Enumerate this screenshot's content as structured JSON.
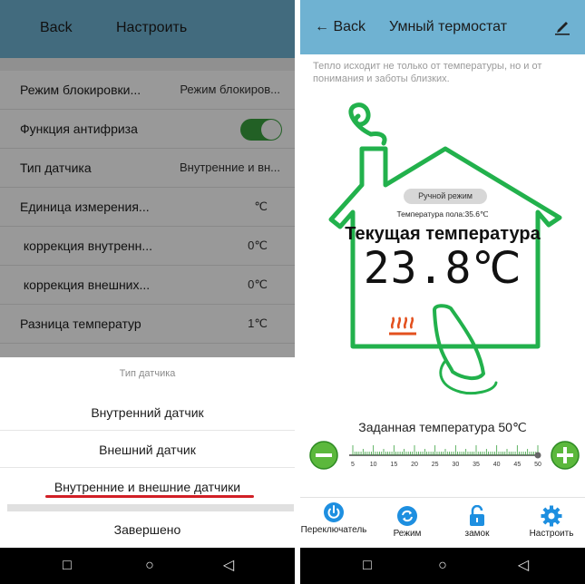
{
  "left": {
    "header": {
      "back": "Back",
      "title": "Настроить"
    },
    "settings": [
      {
        "label": "Режим блокировки...",
        "value": "Режим блокиров..."
      },
      {
        "label": "Функция антифриза",
        "toggle": true
      },
      {
        "label": "Тип датчика",
        "value": "Внутренние и вн..."
      },
      {
        "label": "Единица измерения...",
        "value": "℃"
      },
      {
        "label": " коррекция внутренн...",
        "value": "0℃"
      },
      {
        "label": " коррекция внешних...",
        "value": "0℃"
      },
      {
        "label": "Разница температур",
        "value": "1℃"
      }
    ],
    "sheet": {
      "title": "Тип датчика",
      "options": [
        "Внутренний датчик",
        "Внешний датчик",
        "Внутренние и внешние датчики"
      ],
      "selected_index": 2,
      "done": "Завершено"
    }
  },
  "right": {
    "header": {
      "back": "← Back",
      "title": "Умный термостат"
    },
    "quote": "Тепло исходит не только от температуры, но и от понимания и заботы близких.",
    "mode": "Ручной режим",
    "floor_temp": "Температура пола:35.6℃",
    "current_label": "Текущая температура",
    "current_temp": "23.8℃",
    "set_temp_label": "Заданная температура 50℃",
    "slider": {
      "ticks": [
        "5",
        "10",
        "15",
        "20",
        "25",
        "30",
        "35",
        "40",
        "45",
        "50"
      ],
      "value": 50
    },
    "tabs": [
      {
        "label": "Переключатель",
        "icon": "power-icon"
      },
      {
        "label": "Режим",
        "icon": "sync-icon"
      },
      {
        "label": "замок",
        "icon": "lock-icon"
      },
      {
        "label": "Настроить",
        "icon": "gear-icon"
      }
    ]
  },
  "nav": {
    "square": "□",
    "circle": "○",
    "back": "◁"
  },
  "colors": {
    "header": "#6fb2d2",
    "accent": "#3aa13f",
    "house": "#22b14c",
    "tab_icon": "#1e8fe0",
    "underline": "#d11f26"
  }
}
